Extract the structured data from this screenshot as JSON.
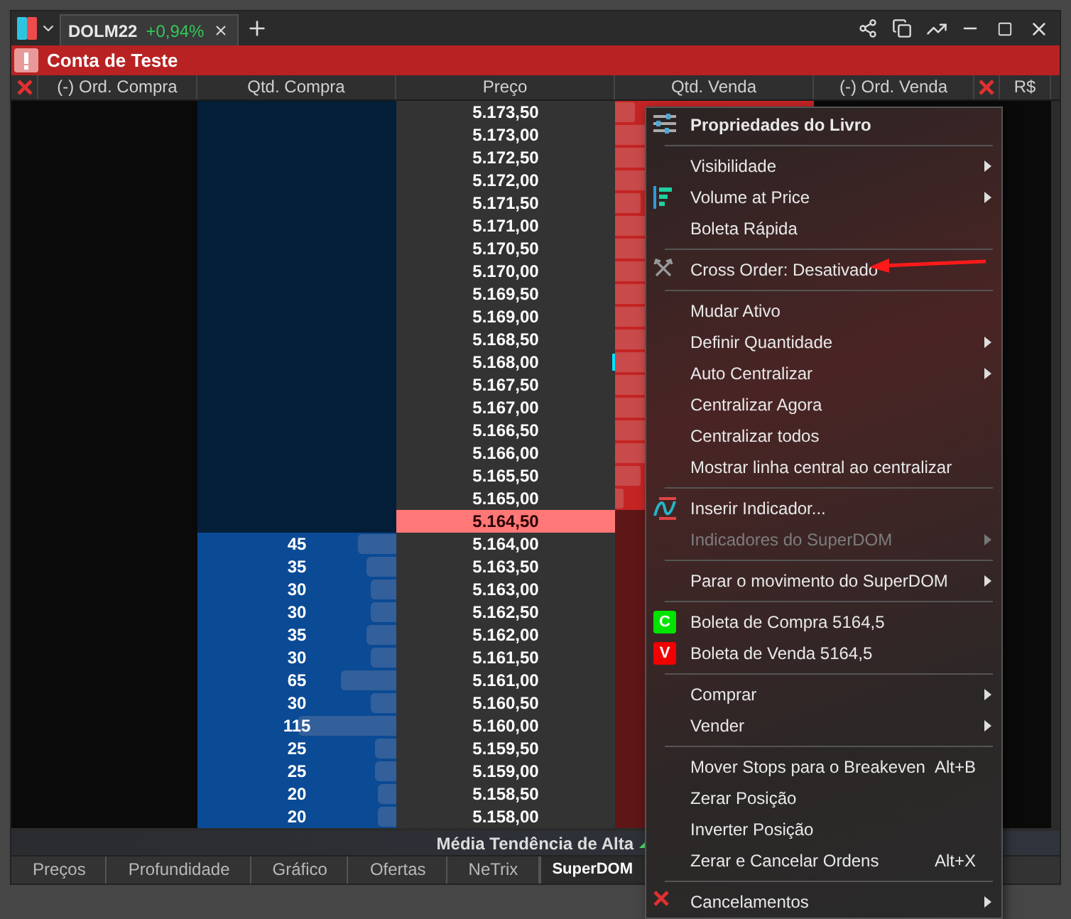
{
  "window": {
    "tab": {
      "symbol": "DOLM22",
      "change": "+0,94%"
    }
  },
  "account_bar": {
    "label": "Conta de Teste"
  },
  "columns": [
    "(-) Ord. Compra",
    "Qtd. Compra",
    "Preço",
    "Qtd. Venda",
    "(-) Ord. Venda",
    "R$"
  ],
  "rows": [
    {
      "kind": "ask",
      "price": "5.173,50",
      "level": 0.1
    },
    {
      "kind": "ask",
      "price": "5.173,00",
      "level": 0.6
    },
    {
      "kind": "ask",
      "price": "5.172,50",
      "level": 0.6
    },
    {
      "kind": "ask",
      "price": "5.172,00",
      "level": 0.6
    },
    {
      "kind": "ask",
      "price": "5.171,50",
      "level": 0.13
    },
    {
      "kind": "ask",
      "price": "5.171,00",
      "level": 0.6
    },
    {
      "kind": "ask",
      "price": "5.170,50",
      "level": 0.6
    },
    {
      "kind": "ask",
      "price": "5.170,00",
      "level": 0.6
    },
    {
      "kind": "ask",
      "price": "5.169,50",
      "level": 0.6
    },
    {
      "kind": "ask",
      "price": "5.169,00",
      "level": 0.6
    },
    {
      "kind": "ask",
      "price": "5.168,50",
      "level": 0.6
    },
    {
      "kind": "ask",
      "price": "5.168,00",
      "level": 0.6,
      "marker": true
    },
    {
      "kind": "ask",
      "price": "5.167,50",
      "level": 0.6
    },
    {
      "kind": "ask",
      "price": "5.167,00",
      "level": 0.6
    },
    {
      "kind": "ask",
      "price": "5.166,50",
      "level": 0.6
    },
    {
      "kind": "ask",
      "price": "5.166,00",
      "level": 0.6
    },
    {
      "kind": "ask",
      "price": "5.165,50",
      "level": 0.13
    },
    {
      "kind": "ask",
      "price": "5.165,00",
      "level": 0.04
    },
    {
      "kind": "last",
      "price": "5.164,50"
    },
    {
      "kind": "bid",
      "price": "5.164,00",
      "qty": "45",
      "level": 0.19
    },
    {
      "kind": "bid",
      "price": "5.163,50",
      "qty": "35",
      "level": 0.15
    },
    {
      "kind": "bid",
      "price": "5.163,00",
      "qty": "30",
      "level": 0.13
    },
    {
      "kind": "bid",
      "price": "5.162,50",
      "qty": "30",
      "level": 0.13
    },
    {
      "kind": "bid",
      "price": "5.162,00",
      "qty": "35",
      "level": 0.15
    },
    {
      "kind": "bid",
      "price": "5.161,50",
      "qty": "30",
      "level": 0.13
    },
    {
      "kind": "bid",
      "price": "5.161,00",
      "qty": "65",
      "level": 0.28
    },
    {
      "kind": "bid",
      "price": "5.160,50",
      "qty": "30",
      "level": 0.13
    },
    {
      "kind": "bid",
      "price": "5.160,00",
      "qty": "115",
      "level": 0.49
    },
    {
      "kind": "bid",
      "price": "5.159,50",
      "qty": "25",
      "level": 0.11
    },
    {
      "kind": "bid",
      "price": "5.159,00",
      "qty": "25",
      "level": 0.11
    },
    {
      "kind": "bid",
      "price": "5.158,50",
      "qty": "20",
      "level": 0.09
    },
    {
      "kind": "bid",
      "price": "5.158,00",
      "qty": "20",
      "level": 0.09
    }
  ],
  "status": {
    "label": "Média Tendência de Alta"
  },
  "bottom_tabs": [
    {
      "label": "Preços",
      "selected": false
    },
    {
      "label": "Profundidade",
      "selected": false
    },
    {
      "label": "Gráfico",
      "selected": false
    },
    {
      "label": "Ofertas",
      "selected": false
    },
    {
      "label": "NeTrix",
      "selected": false
    },
    {
      "label": "SuperDOM",
      "selected": true
    }
  ],
  "context_menu": {
    "items": [
      {
        "kind": "header",
        "label": "Propriedades do Livro"
      },
      {
        "kind": "separator"
      },
      {
        "kind": "item",
        "label": "Visibilidade",
        "submenu": true,
        "disabled": false
      },
      {
        "kind": "item",
        "label": "Volume at Price",
        "submenu": true,
        "disabled": false
      },
      {
        "kind": "item",
        "label": "Boleta Rápida",
        "submenu": false,
        "disabled": false
      },
      {
        "kind": "separator"
      },
      {
        "kind": "item",
        "label": "Cross Order: Desativado",
        "submenu": false,
        "disabled": false
      },
      {
        "kind": "separator"
      },
      {
        "kind": "item",
        "label": "Mudar Ativo",
        "submenu": false,
        "disabled": false
      },
      {
        "kind": "item",
        "label": "Definir Quantidade",
        "submenu": true,
        "disabled": false
      },
      {
        "kind": "item",
        "label": "Auto Centralizar",
        "submenu": true,
        "disabled": false
      },
      {
        "kind": "item",
        "label": "Centralizar Agora",
        "submenu": false,
        "disabled": false
      },
      {
        "kind": "item",
        "label": "Centralizar todos",
        "submenu": false,
        "disabled": false
      },
      {
        "kind": "item",
        "label": "Mostrar linha central ao centralizar",
        "submenu": false,
        "disabled": false
      },
      {
        "kind": "separator"
      },
      {
        "kind": "item",
        "label": "Inserir Indicador...",
        "submenu": false,
        "disabled": false
      },
      {
        "kind": "item",
        "label": "Indicadores do SuperDOM",
        "submenu": true,
        "disabled": true
      },
      {
        "kind": "separator"
      },
      {
        "kind": "item",
        "label": "Parar o movimento do SuperDOM",
        "submenu": true,
        "disabled": false
      },
      {
        "kind": "separator"
      },
      {
        "kind": "item",
        "label": "Boleta de Compra 5164,5",
        "submenu": false,
        "disabled": false,
        "badge": "C",
        "color": "#00e400"
      },
      {
        "kind": "item",
        "label": "Boleta de Venda 5164,5",
        "submenu": false,
        "disabled": false,
        "badge": "V",
        "color": "#f00000"
      },
      {
        "kind": "separator"
      },
      {
        "kind": "item",
        "label": "Comprar",
        "submenu": true,
        "disabled": false
      },
      {
        "kind": "item",
        "label": "Vender",
        "submenu": true,
        "disabled": false
      },
      {
        "kind": "separator"
      },
      {
        "kind": "item",
        "label": "Mover Stops para o Breakeven",
        "submenu": false,
        "disabled": false,
        "shortcut": "Alt+B"
      },
      {
        "kind": "item",
        "label": "Zerar Posição",
        "submenu": false,
        "disabled": false
      },
      {
        "kind": "item",
        "label": "Inverter Posição",
        "submenu": false,
        "disabled": false
      },
      {
        "kind": "item",
        "label": "Zerar e Cancelar Ordens",
        "submenu": false,
        "disabled": false,
        "shortcut": "Alt+X"
      },
      {
        "kind": "separator"
      },
      {
        "kind": "item",
        "label": "Cancelamentos",
        "submenu": true,
        "disabled": false
      }
    ]
  }
}
